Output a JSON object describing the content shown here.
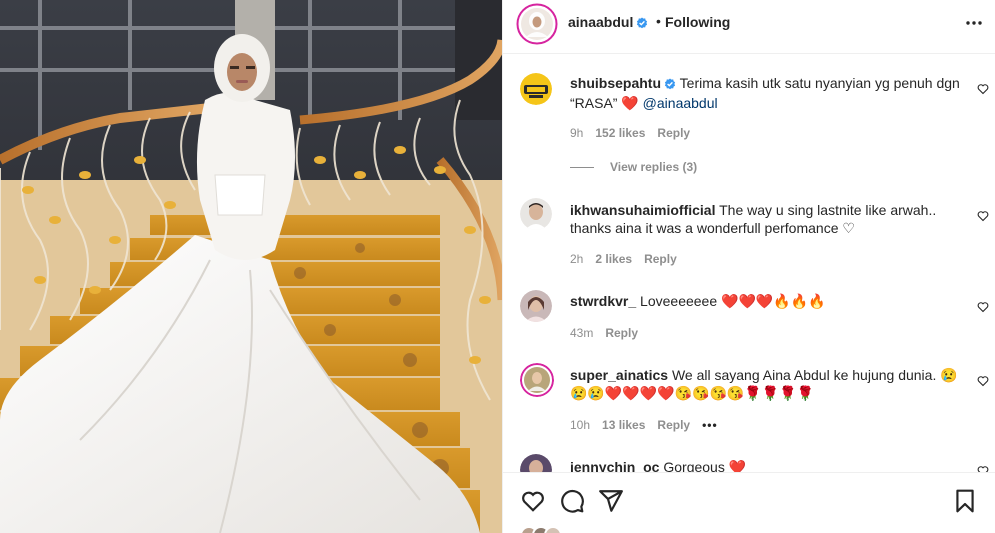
{
  "post": {
    "username": "ainaabdul",
    "separator": "•",
    "follow_status": "Following"
  },
  "comments": [
    {
      "username": "shuibsepahtu",
      "text": "Terima kasih utk satu nyanyian yg penuh dgn “RASA”",
      "emoji": "❤️",
      "mention": "@ainaabdul",
      "time": "9h",
      "likes": "152 likes",
      "reply": "Reply",
      "view_replies": "View replies (3)"
    },
    {
      "username": "ikhwansuhaimiofficial",
      "text": "The way u sing lastnite like arwah.. thanks aina it was a wonderfull perfomance",
      "emoji": "♡",
      "time": "2h",
      "likes": "2 likes",
      "reply": "Reply"
    },
    {
      "username": "stwrdkvr_",
      "text": "Loveeeeeee",
      "emoji": "❤️❤️❤️🔥🔥🔥",
      "time": "43m",
      "reply": "Reply"
    },
    {
      "username": "super_ainatics",
      "text": "We all sayang Aina Abdul ke hujung dunia.",
      "emoji": "😢",
      "emoji_line2": "😢😢❤️❤️❤️❤️😘😘😘😘🌹🌹🌹🌹",
      "time": "10h",
      "likes": "13 likes",
      "reply": "Reply",
      "more": "•••"
    },
    {
      "username": "jennychin_oc",
      "text": "Gorgeous",
      "emoji": "❤️"
    }
  ],
  "icons": {
    "like": "heart-icon",
    "comment": "comment-icon",
    "share": "share-icon",
    "save": "bookmark-icon",
    "more": "more-options-icon",
    "verified": "verified-badge-icon"
  },
  "colors": {
    "verified": "#3897f0",
    "heart": "#ed4956",
    "link": "#00376b",
    "muted": "#8e8e8e"
  }
}
